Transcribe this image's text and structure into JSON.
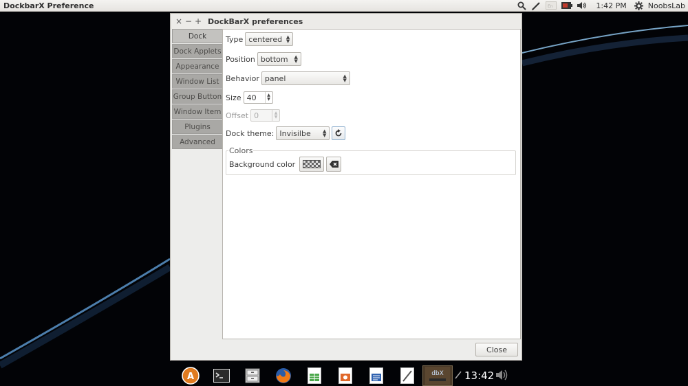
{
  "top_panel": {
    "app_title": "DockbarX Preference",
    "time": "1:42 PM",
    "user": "NoobsLab",
    "icons": [
      "search-icon",
      "pen-icon",
      "keyboard-icon",
      "battery-icon",
      "volume-icon",
      "gear-icon"
    ]
  },
  "dialog": {
    "title": "DockBarX preferences",
    "window_buttons": {
      "close": "×",
      "minimize": "−",
      "maximize": "+"
    },
    "tabs": [
      "Dock",
      "Dock Applets",
      "Appearance",
      "Window List",
      "Group Button",
      "Window Item",
      "Plugins",
      "Advanced"
    ],
    "active_tab": "Dock",
    "fields": {
      "type": {
        "label": "Type",
        "value": "centered"
      },
      "position": {
        "label": "Position",
        "value": "bottom"
      },
      "behavior": {
        "label": "Behavior",
        "value": "panel"
      },
      "size": {
        "label": "Size",
        "value": "40"
      },
      "offset": {
        "label": "Offset",
        "value": "0"
      },
      "dock_theme": {
        "label": "Dock theme:",
        "value": "Invisilbe"
      }
    },
    "colors": {
      "frame_title": "Colors",
      "background_color_label": "Background color"
    },
    "close_label": "Close"
  },
  "dock": {
    "apps": [
      "software-center-icon",
      "terminal-icon",
      "file-manager-icon",
      "firefox-icon",
      "spreadsheet-icon",
      "presentation-icon",
      "document-icon",
      "text-editor-icon",
      "dockbarx-icon"
    ],
    "active_label": "dbX",
    "clock": "13:42"
  },
  "colors": {
    "accent": "#dd4814",
    "wallpaper": "#020306",
    "panel": "#e6e4e0"
  }
}
